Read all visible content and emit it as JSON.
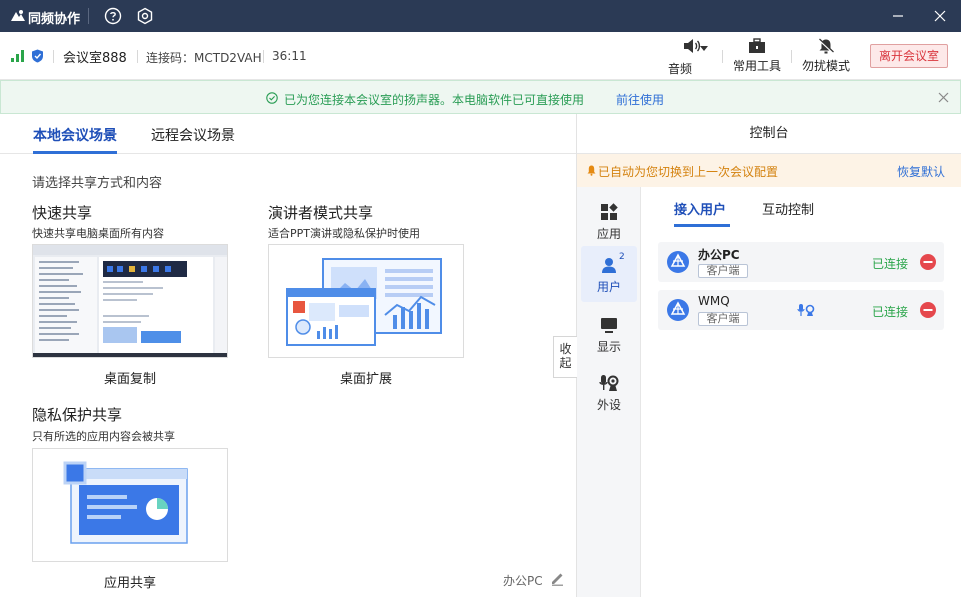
{
  "titlebar": {
    "app_title": "同频协作",
    "icons": [
      "logo-icon",
      "help-icon",
      "gear-icon",
      "minimize-icon",
      "close-icon"
    ]
  },
  "meeting": {
    "room_name": "会议室888",
    "connection_code": "连接码：MCTD2VAH",
    "duration": "36:11",
    "tools": {
      "audio": "音频",
      "common_tools": "常用工具",
      "dnd": "勿扰模式"
    },
    "leave_label": "离开会议室"
  },
  "notice": {
    "text": "已为您连接本会议室的扬声器。本电脑软件已可直接使用",
    "link": "前往使用"
  },
  "left": {
    "tabs": [
      "本地会议场景",
      "远程会议场景"
    ],
    "prompt": "请选择共享方式和内容",
    "quick_share": {
      "title": "快速共享",
      "desc": "快速共享电脑桌面所有内容",
      "thumb_label": "桌面复制"
    },
    "presenter": {
      "title": "演讲者模式共享",
      "desc": "适合PPT演讲或隐私保护时使用",
      "thumb_label": "桌面扩展"
    },
    "privacy": {
      "title": "隐私保护共享",
      "desc": "只有所选的应用内容会被共享",
      "thumb_label": "应用共享"
    },
    "collapse_label": "收起",
    "device_name": "办公PC"
  },
  "right": {
    "title": "控制台",
    "warning": "已自动为您切换到上一次会议配置",
    "restore": "恢复默认",
    "nav": [
      {
        "label": "应用",
        "icon": "apps-icon"
      },
      {
        "label": "用户",
        "icon": "user-icon",
        "badge": "2"
      },
      {
        "label": "显示",
        "icon": "monitor-icon"
      },
      {
        "label": "外设",
        "icon": "peripheral-icon"
      }
    ],
    "subtabs": [
      "接入用户",
      "互动控制"
    ],
    "users": [
      {
        "name": "办公PC",
        "tag": "客户端",
        "status": "已连接"
      },
      {
        "name": "WMQ",
        "tag": "客户端",
        "status": "已连接"
      }
    ]
  },
  "colors": {
    "titlebar": "#2b3a55",
    "accent": "#2f6fd6",
    "success": "#2aa54a",
    "danger": "#d9363e",
    "warning": "#d4820f"
  }
}
